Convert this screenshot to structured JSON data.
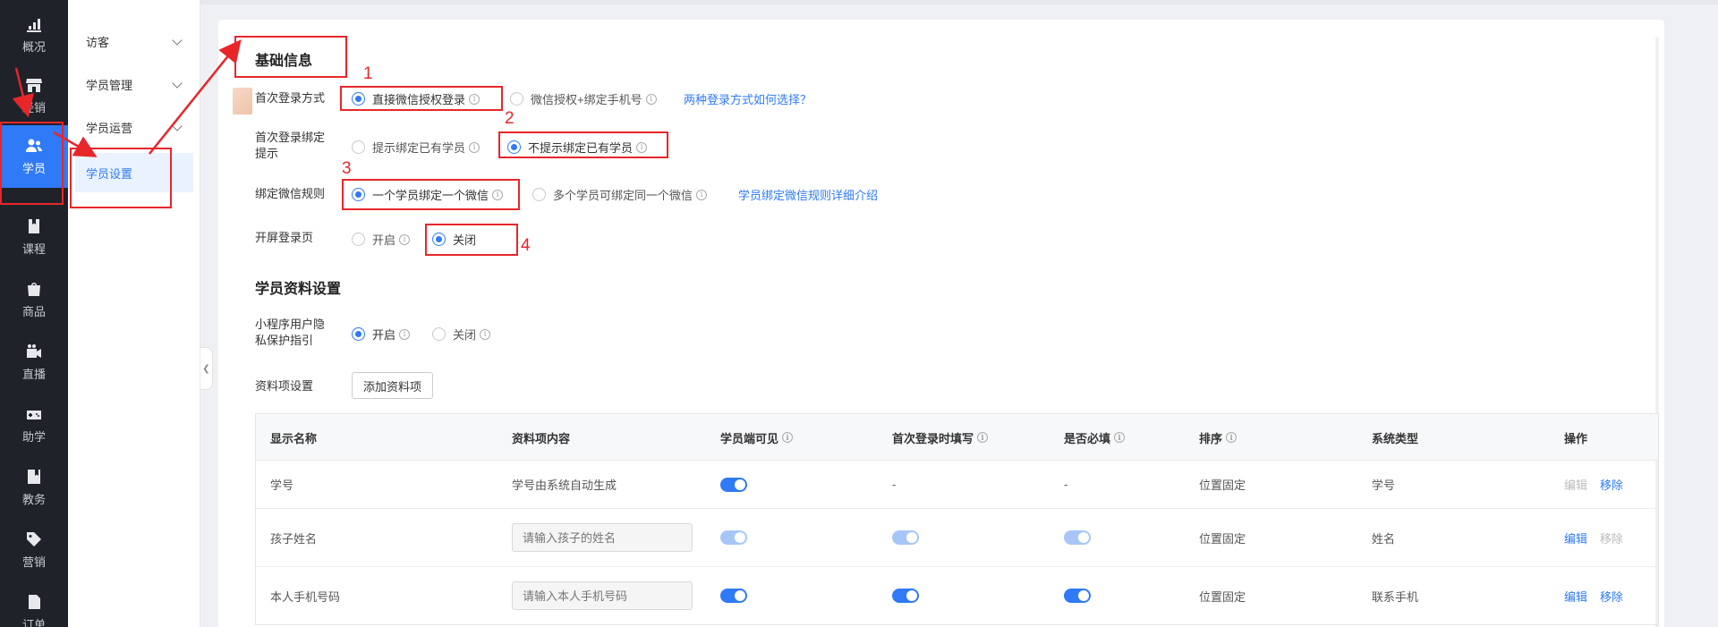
{
  "nav": {
    "items": [
      {
        "label": "概况",
        "icon": "chart-icon"
      },
      {
        "label": "经销",
        "icon": "store-icon"
      },
      {
        "label": "学员",
        "icon": "users-icon",
        "active": true
      },
      {
        "label": "课程",
        "icon": "book-icon"
      },
      {
        "label": "商品",
        "icon": "bag-icon"
      },
      {
        "label": "直播",
        "icon": "video-icon"
      },
      {
        "label": "助学",
        "icon": "gamepad-icon"
      },
      {
        "label": "教务",
        "icon": "bookmark-icon"
      },
      {
        "label": "营销",
        "icon": "tag-icon"
      },
      {
        "label": "订单",
        "icon": "document-icon"
      }
    ]
  },
  "submenu": {
    "items": [
      {
        "label": "访客"
      },
      {
        "label": "学员管理"
      },
      {
        "label": "学员运营"
      },
      {
        "label": "学员设置",
        "active": true
      }
    ]
  },
  "basic": {
    "title": "基础信息",
    "login_method": {
      "label": "首次登录方式",
      "options": [
        "直接微信授权登录",
        "微信授权+绑定手机号"
      ],
      "selected": "直接微信授权登录",
      "help_link": "两种登录方式如何选择？"
    },
    "bind_prompt": {
      "label_line1": "首次登录绑定",
      "label_line2": "提示",
      "options": [
        "提示绑定已有学员",
        "不提示绑定已有学员"
      ],
      "selected": "不提示绑定已有学员"
    },
    "wechat_rule": {
      "label": "绑定微信规则",
      "options": [
        "一个学员绑定一个微信",
        "多个学员可绑定同一个微信"
      ],
      "selected": "一个学员绑定一个微信",
      "help_link": "学员绑定微信规则详细介绍"
    },
    "splash": {
      "label": "开屏登录页",
      "options": [
        "开启",
        "关闭"
      ],
      "selected": "关闭"
    }
  },
  "profile": {
    "title": "学员资料设置",
    "privacy": {
      "label_line1": "小程序用户隐",
      "label_line2": "私保护指引",
      "options": [
        "开启",
        "关闭"
      ],
      "selected": "开启"
    },
    "fields_label": "资料项设置",
    "add_button": "添加资料项"
  },
  "table": {
    "columns": [
      "显示名称",
      "资料项内容",
      "学员端可见",
      "首次登录时填写",
      "是否必填",
      "排序",
      "系统类型",
      "操作"
    ],
    "rows": [
      {
        "name": "学号",
        "content": "学号由系统自动生成",
        "content_type": "text",
        "visible": "on",
        "first_fill": "-",
        "required": "-",
        "order": "位置固定",
        "sys_type": "学号",
        "edit": "编辑",
        "remove": "移除",
        "edit_enabled": false,
        "remove_enabled": true
      },
      {
        "name": "孩子姓名",
        "content": "请输入孩子的姓名",
        "content_type": "input",
        "visible": "disabled",
        "first_fill": "disabled",
        "required": "disabled",
        "order": "位置固定",
        "sys_type": "姓名",
        "edit": "编辑",
        "remove": "移除",
        "edit_enabled": true,
        "remove_enabled": false
      },
      {
        "name": "本人手机号码",
        "content": "请输入本人手机号码",
        "content_type": "input",
        "visible": "on",
        "first_fill": "on",
        "required": "on",
        "order": "位置固定",
        "sys_type": "联系手机",
        "edit": "编辑",
        "remove": "移除",
        "edit_enabled": true,
        "remove_enabled": true
      }
    ]
  },
  "annotations": {
    "labels": [
      "1",
      "2",
      "3",
      "4"
    ],
    "color": "#e8262a"
  },
  "colors": {
    "accent": "#2f7af6",
    "nav_bg": "#1f2229",
    "annotation": "#e8262a"
  }
}
